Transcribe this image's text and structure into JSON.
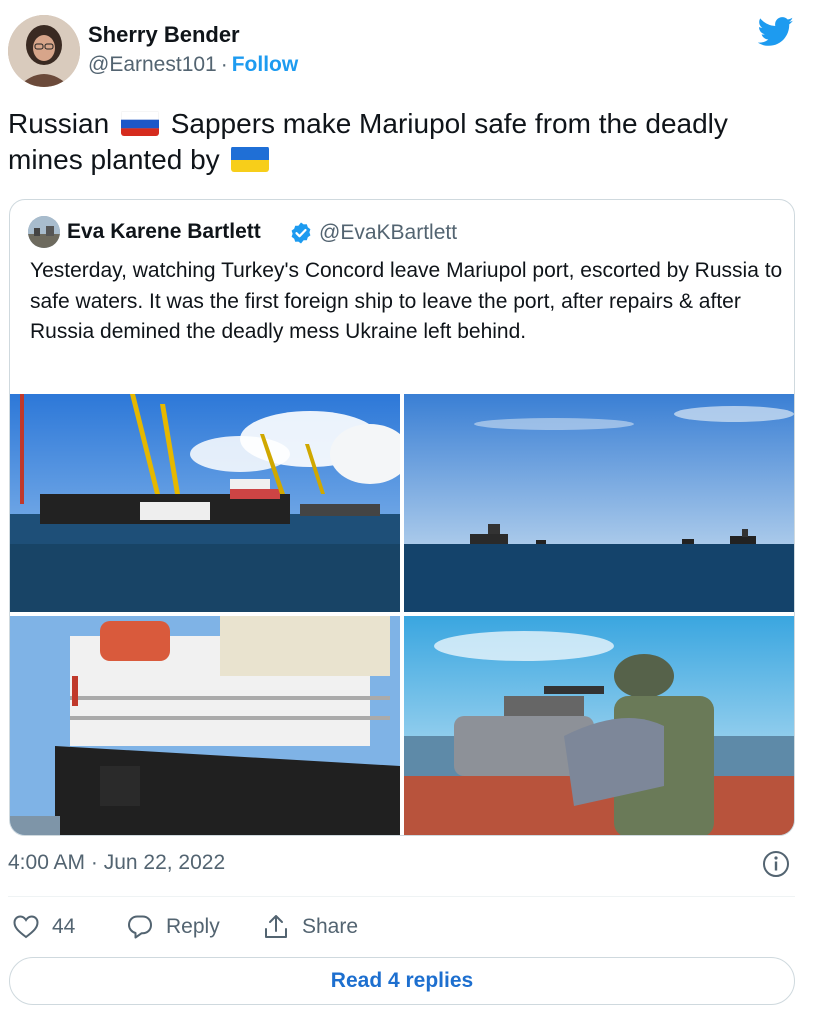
{
  "author": {
    "name": "Sherry Bender",
    "handle": "@Earnest101",
    "separator": "·",
    "follow_label": "Follow"
  },
  "tweet": {
    "text_part1": "Russian",
    "flag1": "russia-flag",
    "text_part2": "Sappers make Mariupol safe from the deadly mines planted by",
    "flag2": "ukraine-flag"
  },
  "quoted": {
    "name": "Eva Karene Bartlett",
    "handle": "@EvaKBartlett",
    "verified": true,
    "text": "Yesterday, watching Turkey's Concord leave Mariupol port, escorted by Russia to safe waters. It was the first foreign ship to leave the port, after repairs & after Russia demined the deadly mess Ukraine left behind.",
    "photos": [
      {
        "description": "port-cranes-and-cargo-ship"
      },
      {
        "description": "ships-on-open-sea"
      },
      {
        "description": "ship-concord-hull"
      },
      {
        "description": "soldier-with-mounted-gun-on-boat"
      }
    ]
  },
  "meta": {
    "timestamp": "4:00 AM · Jun 22, 2022",
    "info_icon": "info-icon"
  },
  "actions": {
    "like_count": "44",
    "reply_label": "Reply",
    "share_label": "Share"
  },
  "read_replies_label": "Read 4 replies",
  "colors": {
    "accent": "#1d9bf0",
    "link": "#1d6fcf",
    "secondary_text": "#536471",
    "border": "#cfd9de"
  }
}
